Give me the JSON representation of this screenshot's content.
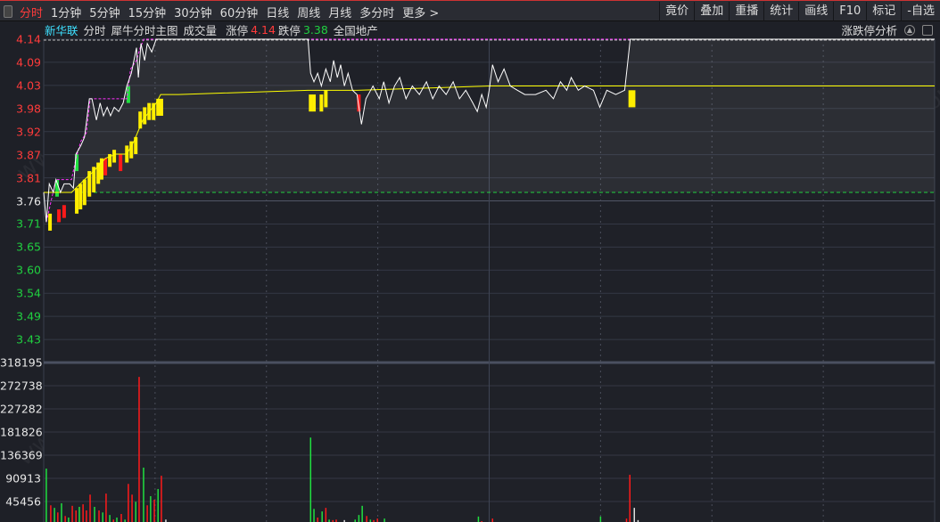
{
  "toolbar": {
    "left": [
      "分时",
      "1分钟",
      "5分钟",
      "15分钟",
      "30分钟",
      "60分钟",
      "日线",
      "周线",
      "月线",
      "多分时",
      "更多 >"
    ],
    "active": 0,
    "right": [
      "竟价",
      "叠加",
      "重播",
      "统计",
      "画线",
      "F10",
      "标记",
      "-自选"
    ]
  },
  "info": {
    "stock": "新华联",
    "tabs": [
      "分时",
      "犀牛分时主图",
      "成交量"
    ],
    "limit_up_label": "涨停",
    "limit_up": "4.14",
    "limit_down_label": "跌停",
    "limit_down": "3.38",
    "sector": "全国地产",
    "analysis": "涨跌停分析"
  },
  "colors": {
    "up": "#ff3b3b",
    "down": "#20d040",
    "price": "#ffffff",
    "avg": "#ffff00",
    "envelope": "#ff30ff",
    "grid": "#3a3f4c"
  },
  "price_axis": {
    "labels": [
      "4.14",
      "4.09",
      "4.03",
      "3.98",
      "3.92",
      "3.87",
      "3.81",
      "3.76",
      "3.71",
      "3.65",
      "3.60",
      "3.54",
      "3.49",
      "3.43"
    ],
    "max": 4.14,
    "min": 3.38,
    "ref_index": 7
  },
  "volume_axis": {
    "labels": [
      "318195",
      "272738",
      "227282",
      "181826",
      "136369",
      "90913",
      "45456"
    ],
    "max": 318195
  },
  "chart_data": {
    "type": "line",
    "minutes": 240,
    "prev_close_line": 3.78,
    "price": [
      [
        0,
        3.78
      ],
      [
        0.7,
        3.71
      ],
      [
        1.5,
        3.8
      ],
      [
        2.6,
        3.78
      ],
      [
        3.3,
        3.81
      ],
      [
        4.5,
        3.78
      ],
      [
        5.5,
        3.8
      ],
      [
        7,
        3.8
      ],
      [
        8,
        3.79
      ],
      [
        8.7,
        3.87
      ],
      [
        10,
        3.89
      ],
      [
        11,
        3.91
      ],
      [
        12.3,
        4.0
      ],
      [
        13,
        4.0
      ],
      [
        14.2,
        3.95
      ],
      [
        15.2,
        3.99
      ],
      [
        16.1,
        3.96
      ],
      [
        17.1,
        3.98
      ],
      [
        18,
        3.96
      ],
      [
        19,
        3.98
      ],
      [
        20.2,
        3.97
      ],
      [
        21.4,
        3.99
      ],
      [
        22.4,
        4.03
      ],
      [
        23.6,
        4.06
      ],
      [
        24.3,
        4.09
      ],
      [
        25,
        4.12
      ],
      [
        25.5,
        4.05
      ],
      [
        26.2,
        4.13
      ],
      [
        27.2,
        4.09
      ],
      [
        27.9,
        4.13
      ],
      [
        29.1,
        4.11
      ],
      [
        30.3,
        4.14
      ],
      [
        71.2,
        4.14
      ],
      [
        71.9,
        4.06
      ],
      [
        72.8,
        4.04
      ],
      [
        73.8,
        4.06
      ],
      [
        74.8,
        4.03
      ],
      [
        76,
        4.07
      ],
      [
        77.2,
        4.04
      ],
      [
        78.1,
        4.09
      ],
      [
        79.1,
        4.05
      ],
      [
        80,
        4.08
      ],
      [
        81,
        4.03
      ],
      [
        82,
        4.06
      ],
      [
        83.2,
        4.02
      ],
      [
        84.4,
        4.01
      ],
      [
        85.6,
        3.94
      ],
      [
        86.8,
        4.0
      ],
      [
        88.7,
        4.03
      ],
      [
        90.4,
        4.0
      ],
      [
        91.6,
        4.04
      ],
      [
        93,
        3.99
      ],
      [
        94.5,
        4.03
      ],
      [
        95.9,
        4.05
      ],
      [
        97.6,
        4.0
      ],
      [
        99.3,
        4.03
      ],
      [
        101.2,
        4.01
      ],
      [
        103.1,
        4.04
      ],
      [
        104.8,
        4.0
      ],
      [
        106.5,
        4.03
      ],
      [
        108.4,
        4.01
      ],
      [
        110.3,
        4.04
      ],
      [
        112,
        4.0
      ],
      [
        113.7,
        4.02
      ],
      [
        115.6,
        3.99
      ],
      [
        116.8,
        3.97
      ],
      [
        118,
        4.01
      ],
      [
        119.2,
        3.98
      ],
      [
        120,
        4.02
      ],
      [
        120.9,
        4.08
      ],
      [
        122.4,
        4.04
      ],
      [
        124,
        4.07
      ],
      [
        125.7,
        4.03
      ],
      [
        127.6,
        4.02
      ],
      [
        129.6,
        4.01
      ],
      [
        132.5,
        4.01
      ],
      [
        135.3,
        4.02
      ],
      [
        137.3,
        4.0
      ],
      [
        139.2,
        4.04
      ],
      [
        140.9,
        4.02
      ],
      [
        142.1,
        4.05
      ],
      [
        144,
        4.02
      ],
      [
        145.7,
        4.03
      ],
      [
        148.1,
        4.02
      ],
      [
        149.8,
        3.98
      ],
      [
        151.7,
        4.02
      ],
      [
        154.1,
        4.01
      ],
      [
        156.5,
        4.02
      ],
      [
        158,
        4.14
      ],
      [
        240,
        4.14
      ]
    ],
    "avg": [
      [
        0,
        3.78
      ],
      [
        2.6,
        3.78
      ],
      [
        7.5,
        3.78
      ],
      [
        11,
        3.81
      ],
      [
        13.5,
        3.83
      ],
      [
        16.6,
        3.86
      ],
      [
        19.5,
        3.87
      ],
      [
        22.4,
        3.87
      ],
      [
        24.3,
        3.9
      ],
      [
        26.7,
        3.95
      ],
      [
        30.3,
        3.99
      ],
      [
        31.5,
        4.01
      ],
      [
        36.3,
        4.01
      ],
      [
        71.2,
        4.02
      ],
      [
        84.4,
        4.02
      ],
      [
        120.4,
        4.03
      ],
      [
        156.5,
        4.03
      ],
      [
        161.3,
        4.03
      ],
      [
        240,
        4.03
      ]
    ],
    "envelope": [
      [
        0.7,
        3.71
      ],
      [
        3.3,
        3.81
      ],
      [
        7.5,
        3.81
      ],
      [
        8.7,
        3.86
      ],
      [
        10,
        3.9
      ],
      [
        11.5,
        3.92
      ],
      [
        12.5,
        4.0
      ],
      [
        22.4,
        4.0
      ],
      [
        23.4,
        4.07
      ],
      [
        25,
        4.09
      ],
      [
        26,
        4.12
      ],
      [
        27,
        4.14
      ],
      [
        240,
        4.14
      ]
    ],
    "indicator_bars": [
      [
        1.7,
        3.73,
        3.69,
        "y"
      ],
      [
        3.6,
        3.81,
        3.77,
        "g"
      ],
      [
        4.1,
        3.74,
        3.71,
        "r"
      ],
      [
        5.5,
        3.75,
        3.72,
        "r"
      ],
      [
        8.9,
        3.87,
        3.83,
        "g"
      ],
      [
        8.9,
        3.79,
        3.73,
        "y"
      ],
      [
        9.9,
        3.8,
        3.74,
        "y"
      ],
      [
        11,
        3.81,
        3.75,
        "y"
      ],
      [
        12.3,
        3.83,
        3.77,
        "y"
      ],
      [
        13.5,
        3.84,
        3.78,
        "y"
      ],
      [
        14.7,
        3.85,
        3.8,
        "y"
      ],
      [
        15.6,
        3.86,
        3.81,
        "y"
      ],
      [
        16.6,
        3.86,
        3.82,
        "r"
      ],
      [
        17.8,
        3.87,
        3.84,
        "y"
      ],
      [
        19,
        3.88,
        3.85,
        "y"
      ],
      [
        20.7,
        3.87,
        3.83,
        "r"
      ],
      [
        22.8,
        4.03,
        3.99,
        "g"
      ],
      [
        22.4,
        3.89,
        3.85,
        "y"
      ],
      [
        23.6,
        3.9,
        3.86,
        "y"
      ],
      [
        24.8,
        3.91,
        3.87,
        "y"
      ],
      [
        26,
        3.97,
        3.93,
        "y"
      ],
      [
        27.2,
        3.98,
        3.94,
        "y"
      ],
      [
        28.4,
        3.99,
        3.95,
        "y"
      ],
      [
        29.6,
        3.99,
        3.95,
        "y"
      ],
      [
        30.8,
        4.0,
        3.96,
        "y"
      ],
      [
        31.7,
        4.0,
        3.96,
        "y"
      ],
      [
        71.9,
        4.01,
        3.97,
        "y"
      ],
      [
        72.8,
        4.01,
        3.97,
        "y"
      ],
      [
        74.8,
        4.01,
        3.97,
        "y"
      ],
      [
        76,
        4.02,
        3.98,
        "y"
      ],
      [
        84.9,
        4.01,
        3.97,
        "r"
      ],
      [
        158,
        4.02,
        3.98,
        "y"
      ],
      [
        158.9,
        4.02,
        3.98,
        "y"
      ]
    ],
    "volume": [
      [
        0.7,
        110000,
        "g"
      ],
      [
        1.9,
        38000,
        "r"
      ],
      [
        2.9,
        33000,
        "g"
      ],
      [
        3.8,
        24000,
        "r"
      ],
      [
        4.8,
        42000,
        "g"
      ],
      [
        5.8,
        17000,
        "r"
      ],
      [
        6.7,
        14000,
        "g"
      ],
      [
        7.7,
        37000,
        "r"
      ],
      [
        8.7,
        28000,
        "r"
      ],
      [
        9.6,
        35000,
        "g"
      ],
      [
        10.6,
        40000,
        "r"
      ],
      [
        11.5,
        28000,
        "r"
      ],
      [
        12.5,
        59000,
        "r"
      ],
      [
        13.7,
        35000,
        "g"
      ],
      [
        14.9,
        28000,
        "r"
      ],
      [
        15.9,
        24000,
        "g"
      ],
      [
        16.8,
        61000,
        "r"
      ],
      [
        17.8,
        19000,
        "g"
      ],
      [
        18.8,
        10000,
        "r"
      ],
      [
        19.7,
        14000,
        "g"
      ],
      [
        20.9,
        21000,
        "r"
      ],
      [
        21.9,
        10000,
        "g"
      ],
      [
        22.8,
        80000,
        "r"
      ],
      [
        23.8,
        59000,
        "r"
      ],
      [
        24.8,
        45000,
        "g"
      ],
      [
        25.7,
        290000,
        "r"
      ],
      [
        26.9,
        112000,
        "g"
      ],
      [
        27.9,
        38000,
        "r"
      ],
      [
        28.8,
        56000,
        "g"
      ],
      [
        29.8,
        49000,
        "r"
      ],
      [
        30.8,
        70000,
        "g"
      ],
      [
        31.7,
        96000,
        "r"
      ],
      [
        32.9,
        10000,
        "w"
      ],
      [
        71.9,
        171000,
        "g"
      ],
      [
        72.8,
        31000,
        "g"
      ],
      [
        73.8,
        14000,
        "r"
      ],
      [
        75,
        26000,
        "g"
      ],
      [
        76,
        33000,
        "r"
      ],
      [
        76.9,
        10000,
        "g"
      ],
      [
        77.9,
        9000,
        "r"
      ],
      [
        78.8,
        10000,
        "r"
      ],
      [
        81,
        9000,
        "w"
      ],
      [
        83.9,
        10000,
        "g"
      ],
      [
        84.9,
        19000,
        "g"
      ],
      [
        85.8,
        37000,
        "g"
      ],
      [
        87,
        17000,
        "r"
      ],
      [
        88,
        10000,
        "g"
      ],
      [
        88.9,
        9000,
        "r"
      ],
      [
        89.9,
        12000,
        "r"
      ],
      [
        91.8,
        12000,
        "g"
      ],
      [
        117.1,
        16000,
        "g"
      ],
      [
        118,
        7000,
        "r"
      ],
      [
        120.9,
        12000,
        "r"
      ],
      [
        150,
        16000,
        "g"
      ],
      [
        157,
        12000,
        "r"
      ],
      [
        157.9,
        98000,
        "r"
      ],
      [
        159.1,
        33000,
        "w"
      ],
      [
        160.1,
        9000,
        "w"
      ]
    ]
  }
}
